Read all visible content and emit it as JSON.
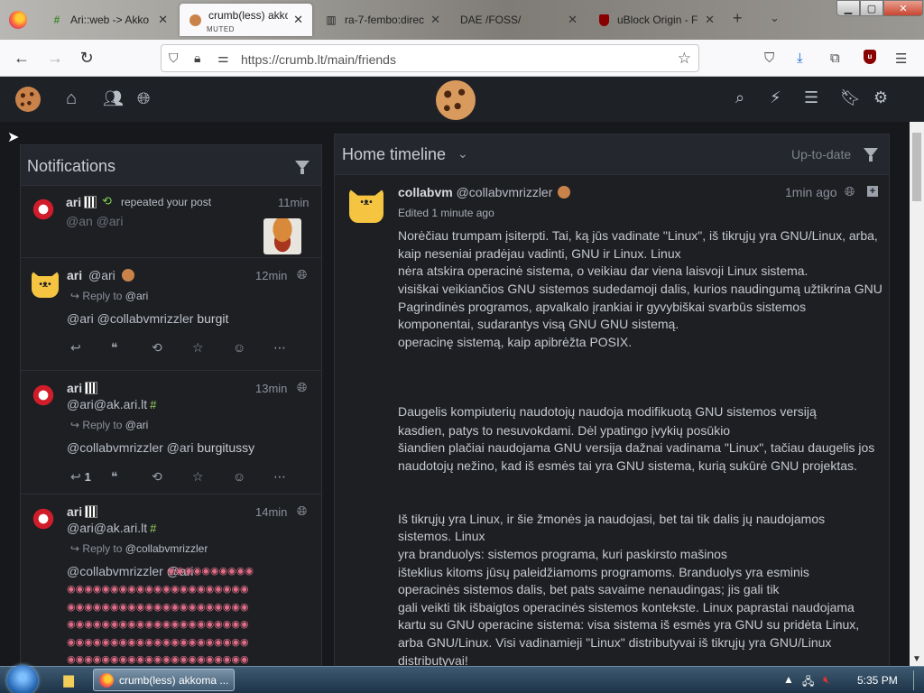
{
  "browser": {
    "tabs": [
      {
        "label": "Ari::web -> Akko",
        "icon": "hashtag-icon"
      },
      {
        "label": "crumb(less) akkoma",
        "sublabel": "MUTED",
        "icon": "cookie-icon",
        "active": true
      },
      {
        "label": "ra-7-fembo:direc",
        "icon": "library-icon"
      },
      {
        "label": "DAE /FOSS/",
        "icon": "none"
      },
      {
        "label": "uBlock Origin - F",
        "icon": "ublock-icon"
      }
    ],
    "url": "https://crumb.lt/main/friends",
    "new_tab": "+",
    "tab_list": "⌄"
  },
  "app": {
    "brand_colors": {
      "background": "#16181c",
      "panel": "#1d1f23",
      "accent_green": "#9bd15a",
      "avatar_red": "#d11d2a"
    }
  },
  "notifications": {
    "title": "Notifications",
    "items": [
      {
        "user": "ari",
        "handle": "@an @ari",
        "action": "repeated your post",
        "time": "11min"
      },
      {
        "user": "ari",
        "handle": "@ari",
        "time": "12min",
        "reply_prefix": "Reply to",
        "reply_to": "@ari",
        "text_mentions": "@ari @collabvmrizzler",
        "text": "burgit"
      },
      {
        "user": "ari",
        "handle": "@ari@ak.ari.lt",
        "time": "13min",
        "reply_prefix": "Reply to",
        "reply_to": "@ari",
        "text_mentions": "@collabvmrizzler @ari",
        "text": "burgitussy",
        "reply_count": "1"
      },
      {
        "user": "ari",
        "handle": "@ari@ak.ari.lt",
        "time": "14min",
        "reply_prefix": "Reply to",
        "reply_to": "@collabvmrizzler",
        "text_mentions": "@collabvmrizzler @ari"
      }
    ]
  },
  "timeline": {
    "title": "Home timeline",
    "status": "Up-to-date",
    "post": {
      "display_name": "collabvm",
      "handle": "@collabvmrizzler",
      "time": "1min ago",
      "edited": "Edited 1 minute ago",
      "lines": [
        "Norėčiau trumpam įsiterpti. Tai, ką jūs vadinate \"Linux\", iš tikrųjų yra GNU/Linux, arba,",
        "kaip neseniai pradėjau vadinti, GNU ir Linux. Linux",
        "nėra atskira operacinė sistema, o veikiau dar viena laisvoji Linux sistema.",
        "visiškai veikiančios GNU sistemos sudedamoji dalis, kurios naudingumą užtikrina GNU",
        "Pagrindinės programos, apvalkalo įrankiai ir gyvybiškai svarbūs sistemos",
        "komponentai, sudarantys visą GNU GNU sistemą.",
        "operacinę sistemą, kaip apibrėžta POSIX.",
        "Daugelis kompiuterių naudotojų naudoja modifikuotą GNU sistemos versiją",
        "kasdien, patys to nesuvokdami. Dėl ypatingo įvykių posūkio",
        "šiandien plačiai naudojama GNU versija dažnai vadinama \"Linux\", tačiau daugelis jos",
        "naudotojų nežino, kad iš esmės tai yra GNU sistema, kurią sukūrė GNU projektas.",
        "Iš tikrųjų yra Linux, ir šie žmonės ja naudojasi, bet tai tik dalis jų naudojamos",
        "sistemos. Linux",
        "yra branduolys: sistemos programa, kuri paskirsto mašinos",
        "išteklius kitoms jūsų paleidžiamoms programoms. Branduolys yra esminis",
        "operacinės sistemos dalis, bet pats savaime nenaudingas; jis gali tik",
        "gali veikti tik išbaigtos operacinės sistemos kontekste. Linux paprastai naudojama",
        "kartu su GNU operacine sistema: visa sistema iš esmės yra GNU su pridėta Linux,",
        "arba GNU/Linux. Visi vadinamieji \"Linux\" distributyvai iš tikrųjų yra GNU/Linux",
        "distributyvai!"
      ]
    }
  },
  "taskbar": {
    "app_label": "crumb(less) akkoma ...",
    "clock": "5:35 PM"
  }
}
